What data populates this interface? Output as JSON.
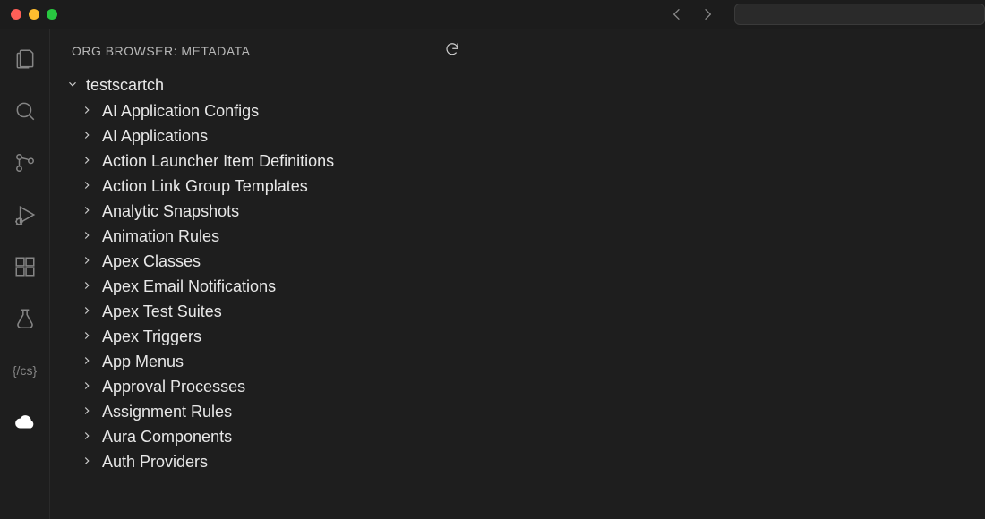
{
  "panel": {
    "title": "ORG BROWSER: METADATA"
  },
  "tree": {
    "root_label": "testscartch",
    "items": [
      {
        "label": "AI Application Configs"
      },
      {
        "label": "AI Applications"
      },
      {
        "label": "Action Launcher Item Definitions"
      },
      {
        "label": "Action Link Group Templates"
      },
      {
        "label": "Analytic Snapshots"
      },
      {
        "label": "Animation Rules"
      },
      {
        "label": "Apex Classes"
      },
      {
        "label": "Apex Email Notifications"
      },
      {
        "label": "Apex Test Suites"
      },
      {
        "label": "Apex Triggers"
      },
      {
        "label": "App Menus"
      },
      {
        "label": "Approval Processes"
      },
      {
        "label": "Assignment Rules"
      },
      {
        "label": "Aura Components"
      },
      {
        "label": "Auth Providers"
      }
    ]
  },
  "activity_bar": {
    "cs_label": "{/cs}"
  }
}
